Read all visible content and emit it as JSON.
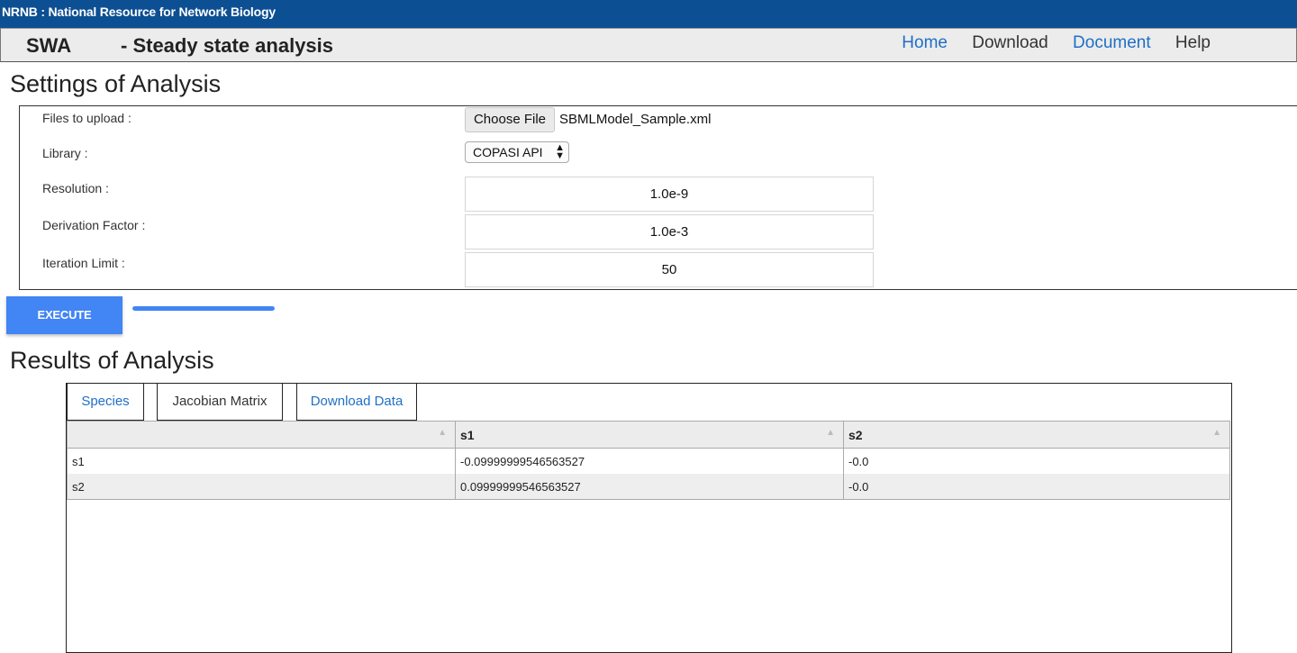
{
  "topbar": {
    "title": "NRNB : National Resource for Network Biology"
  },
  "header": {
    "brand": "SWA",
    "subtitle": "- Steady state analysis"
  },
  "nav": {
    "home": "Home",
    "download": "Download",
    "document": "Document",
    "help": "Help"
  },
  "settings": {
    "title": "Settings of Analysis",
    "files_label": "Files to upload :",
    "choose_file": "Choose File",
    "file_name": "SBMLModel_Sample.xml",
    "library_label": "Library :",
    "library_value": "COPASI API",
    "resolution_label": "Resolution :",
    "resolution_value": "1.0e-9",
    "derivation_label": "Derivation Factor :",
    "derivation_value": "1.0e-3",
    "iteration_label": "Iteration Limit :",
    "iteration_value": "50",
    "execute": "EXECUTE"
  },
  "results": {
    "title": "Results of Analysis",
    "tabs": [
      "Species",
      "Jacobian Matrix",
      "Download Data"
    ],
    "columns": [
      "",
      "s1",
      "s2"
    ],
    "rows": [
      [
        "s1",
        "-0.09999999546563527",
        "-0.0"
      ],
      [
        "s2",
        "0.09999999546563527",
        "-0.0"
      ]
    ]
  },
  "colors": {
    "topbar": "#0d4f93",
    "accent": "#4285f4",
    "link": "#1f6fc5"
  },
  "progress_fraction": 1.0
}
